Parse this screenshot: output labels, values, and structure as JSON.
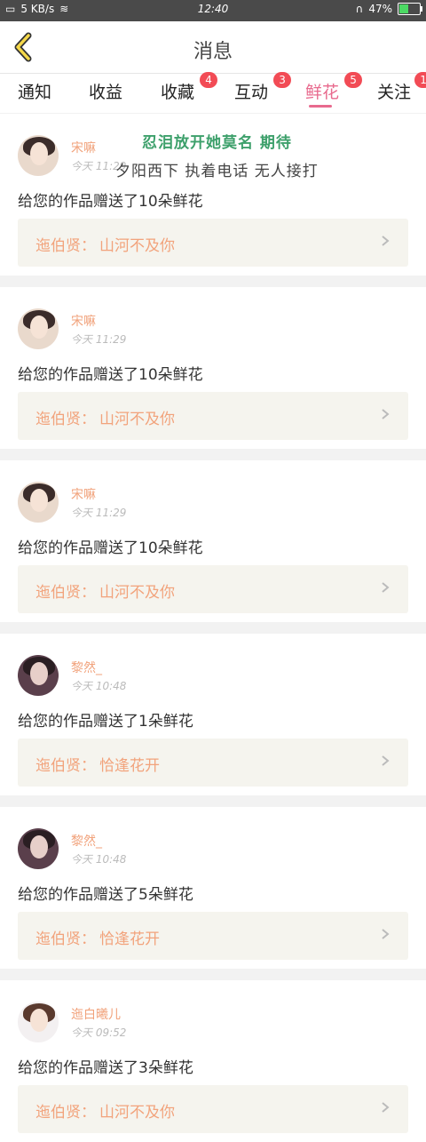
{
  "status_bar": {
    "net_speed": "5 KB/s",
    "time": "12:40",
    "battery_percent": "47%",
    "battery_level": 0.47
  },
  "header": {
    "title": "消息"
  },
  "tabs": [
    {
      "label": "通知",
      "badge": ""
    },
    {
      "label": "收益",
      "badge": ""
    },
    {
      "label": "收藏",
      "badge": "4"
    },
    {
      "label": "互动",
      "badge": "3"
    },
    {
      "label": "鲜花",
      "badge": "5",
      "active": true
    },
    {
      "label": "关注",
      "badge": "1"
    }
  ],
  "overlay": {
    "line1": "忍泪放开她莫名 期待",
    "line2": "夕阳西下 执着电话 无人接打"
  },
  "messages": [
    {
      "name": "宋嘛",
      "time": "今天 11:29",
      "text": "给您的作品赠送了10朵鲜花",
      "work_label": "迤伯贤：",
      "work_title": "山河不及你"
    },
    {
      "name": "宋嘛",
      "time": "今天 11:29",
      "text": "给您的作品赠送了10朵鲜花",
      "work_label": "迤伯贤：",
      "work_title": "山河不及你"
    },
    {
      "name": "宋嘛",
      "time": "今天 11:29",
      "text": "给您的作品赠送了10朵鲜花",
      "work_label": "迤伯贤：",
      "work_title": "山河不及你"
    },
    {
      "name": "黎然_",
      "time": "今天 10:48",
      "text": "给您的作品赠送了1朵鲜花",
      "work_label": "迤伯贤：",
      "work_title": "恰逢花开"
    },
    {
      "name": "黎然_",
      "time": "今天 10:48",
      "text": "给您的作品赠送了5朵鲜花",
      "work_label": "迤伯贤：",
      "work_title": "恰逢花开"
    },
    {
      "name": "迤白曦儿",
      "time": "今天 09:52",
      "text": "给您的作品赠送了3朵鲜花",
      "work_label": "迤伯贤：",
      "work_title": "山河不及你"
    }
  ],
  "colors": {
    "accent": "#e86a8e",
    "badge": "#f24b55",
    "name": "#f1a27b",
    "work_text": "#f2a37c",
    "work_bg": "#f5f4ee"
  }
}
